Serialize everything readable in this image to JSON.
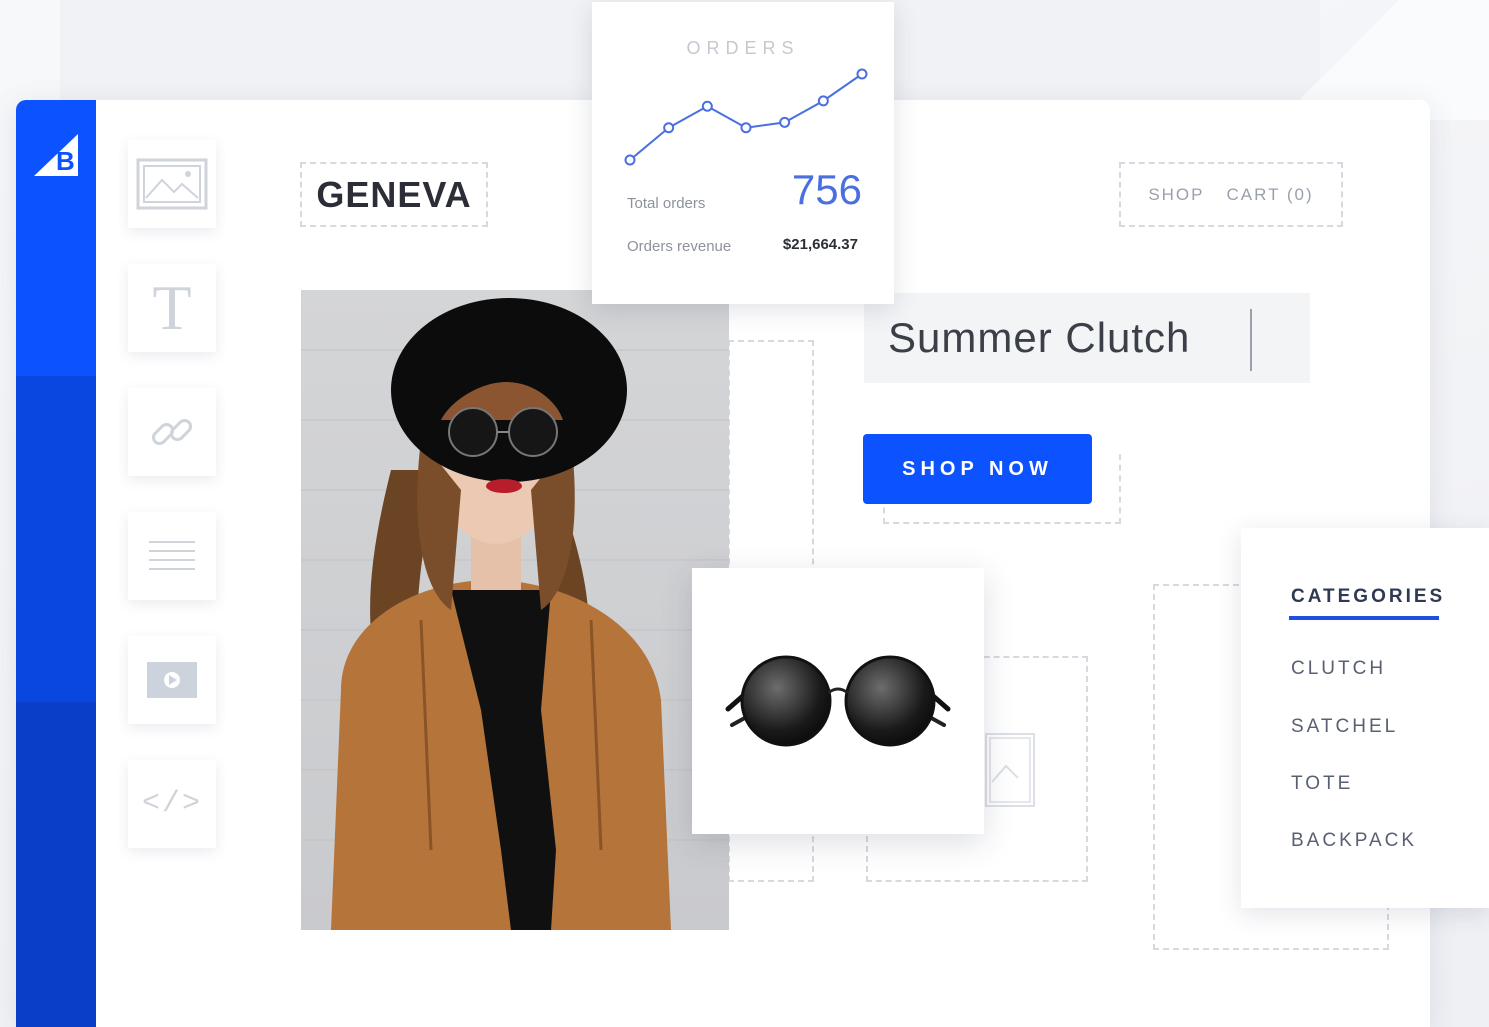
{
  "brand": {
    "store_name": "GENEVA"
  },
  "nav": {
    "shop": "SHOP",
    "cart": "CART (0)"
  },
  "product": {
    "title": "Summer Clutch",
    "cta": "SHOP NOW"
  },
  "orders_widget": {
    "title": "ORDERS",
    "total_label": "Total orders",
    "total_value": "756",
    "revenue_label": "Orders revenue",
    "revenue_value": "$21,664.37",
    "chart_data": {
      "type": "line",
      "values": [
        0,
        3,
        5,
        3,
        3.5,
        5.5,
        8
      ]
    }
  },
  "categories": {
    "title": "CATEGORIES",
    "items": [
      "CLUTCH",
      "SATCHEL",
      "TOTE",
      "BACKPACK"
    ]
  },
  "toolbar": {
    "tools": [
      "image-tool-icon",
      "text-tool-icon",
      "link-tool-icon",
      "divider-tool-icon",
      "video-tool-icon",
      "code-tool-icon"
    ]
  },
  "colors": {
    "brand": "#0d52ff",
    "accent_line": "#4a6fe0"
  }
}
